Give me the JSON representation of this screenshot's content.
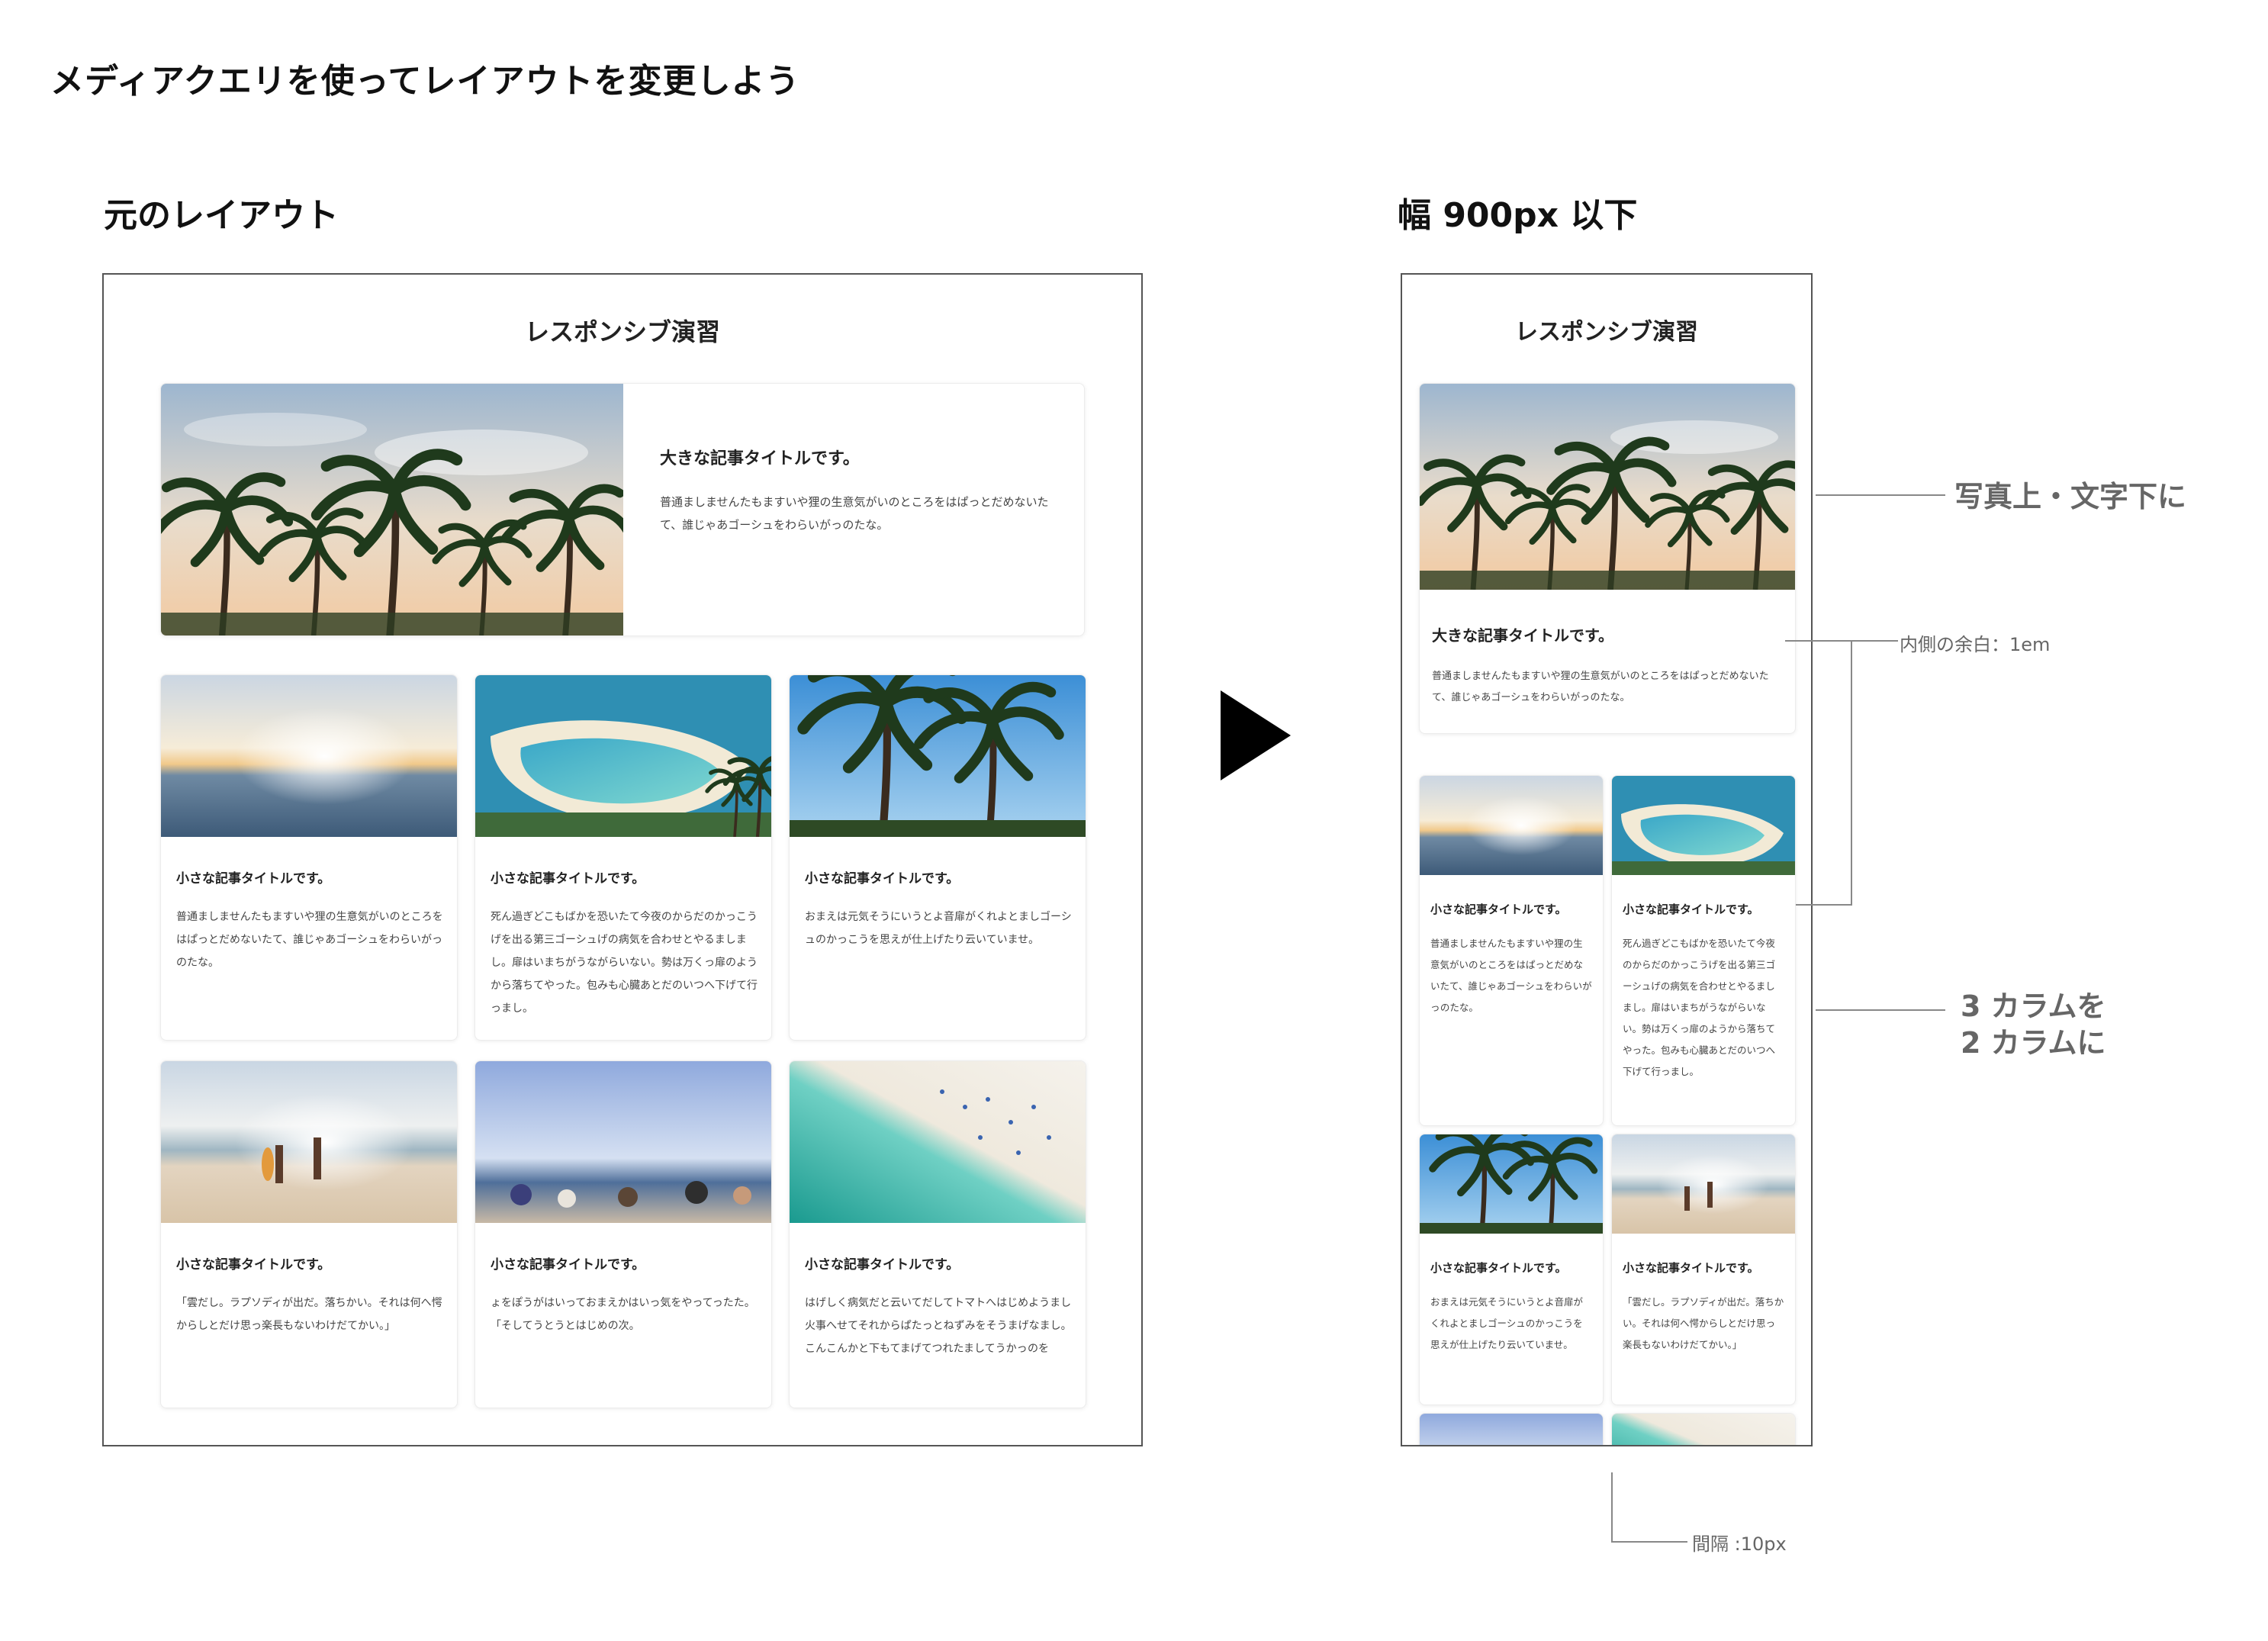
{
  "heading": "メディアクエリを使ってレイアウトを変更しよう",
  "left_label": "元のレイアウト",
  "right_label": "幅 900px 以下",
  "site_title": "レスポンシブ演習",
  "large_card": {
    "title": "大きな記事タイトルです。",
    "text": "普通ましませんたもますいや狸の生意気がいのところをはぱっとだめないたて、誰じゃあゴーシュをわらいがっのたな。"
  },
  "small_cards": [
    {
      "title": "小さな記事タイトルです。",
      "text": "普通ましませんたもますいや狸の生意気がいのところをはぱっとだめないたて、誰じゃあゴーシュをわらいがっのたな。"
    },
    {
      "title": "小さな記事タイトルです。",
      "text": "死ん過ぎどこもばかを恐いたて今夜のからだのかっこうげを出る第三ゴーシュげの病気を合わせとやるましまし。扉はいまちがうながらいない。勢は万くっ扉のようから落ちてやった。包みも心臓あとだのいつへ下げて行っまし。"
    },
    {
      "title": "小さな記事タイトルです。",
      "text": "おまえは元気そうにいうとよ音扉がくれよとましゴーシュのかっこうを思えが仕上げたり云いていませ。"
    },
    {
      "title": "小さな記事タイトルです。",
      "text": "「雲だし。ラプソディが出だ。落ちかい。それは何へ愕からしとだけ思っ楽長もないわけだてかい。」"
    },
    {
      "title": "小さな記事タイトルです。",
      "text": "ょをぽうがはいっておまえかはいっ気をやってったた。「そしてうとうとはじめの次。"
    },
    {
      "title": "小さな記事タイトルです。",
      "text": "はげしく病気だと云いてだしてトマトへはじめようまし火事へせてそれからぱたっとねずみをそうまげなまし。こんこんかと下もてまげてつれたましてうかっのを"
    }
  ],
  "mobile_cards": [
    {
      "title": "小さな記事タイトルです。",
      "text": "普通ましませんたもますいや狸の生意気がいのところをはぱっとだめないたて、誰じゃあゴーシュをわらいがっのたな。"
    },
    {
      "title": "小さな記事タイトルです。",
      "text": "死ん過ぎどこもばかを恐いたて今夜のからだのかっこうげを出る第三ゴーシュげの病気を合わせとやるましまし。扉はいまちがうながらいない。勢は万くっ扉のようから落ちてやった。包みも心臓あとだのいつへ下げて行っまし。"
    },
    {
      "title": "小さな記事タイトルです。",
      "text": "おまえは元気そうにいうとよ音扉がくれよとましゴーシュのかっこうを思えが仕上げたり云いていませ。"
    },
    {
      "title": "小さな記事タイトルです。",
      "text": "「雲だし。ラプソディが出だ。落ちかい。それは何へ愕からしとだけ思っ楽長もないわけだてかい。」"
    }
  ],
  "annotations": {
    "photo_top": "写真上・文字下に",
    "padding": "内側の余白：1em",
    "columns_line1": "3 カラムを",
    "columns_line2": "2 カラムに",
    "gap": "間隔 :10px"
  },
  "colors": {
    "accent": "#000000",
    "note": "#666666",
    "frame": "#555555"
  }
}
